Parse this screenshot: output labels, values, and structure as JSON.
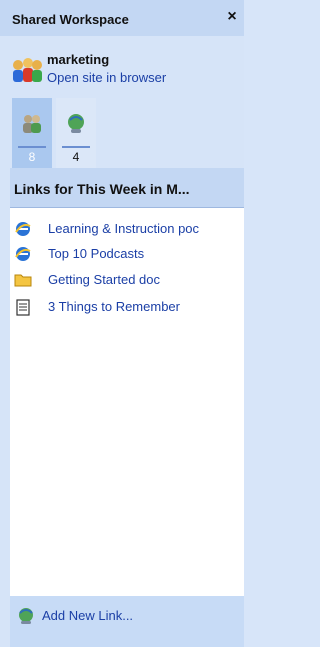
{
  "titlebar": {
    "title": "Shared Workspace",
    "close": "×"
  },
  "site": {
    "name": "marketing",
    "open_link": "Open site in browser"
  },
  "tabs": [
    {
      "name": "members",
      "count": "8",
      "active": true,
      "icon": "people-icon"
    },
    {
      "name": "links",
      "count": "4",
      "active": false,
      "icon": "link-globe-icon"
    }
  ],
  "links": {
    "header": "Links for This Week in M...",
    "items": [
      {
        "label": "Learning & Instruction poc",
        "icon": "ie-icon"
      },
      {
        "label": "Top 10 Podcasts",
        "icon": "ie-icon"
      },
      {
        "label": "Getting Started doc",
        "icon": "folder-icon"
      },
      {
        "label": "3 Things to Remember",
        "icon": "document-icon"
      }
    ]
  },
  "footer": {
    "add_link": "Add New Link..."
  }
}
